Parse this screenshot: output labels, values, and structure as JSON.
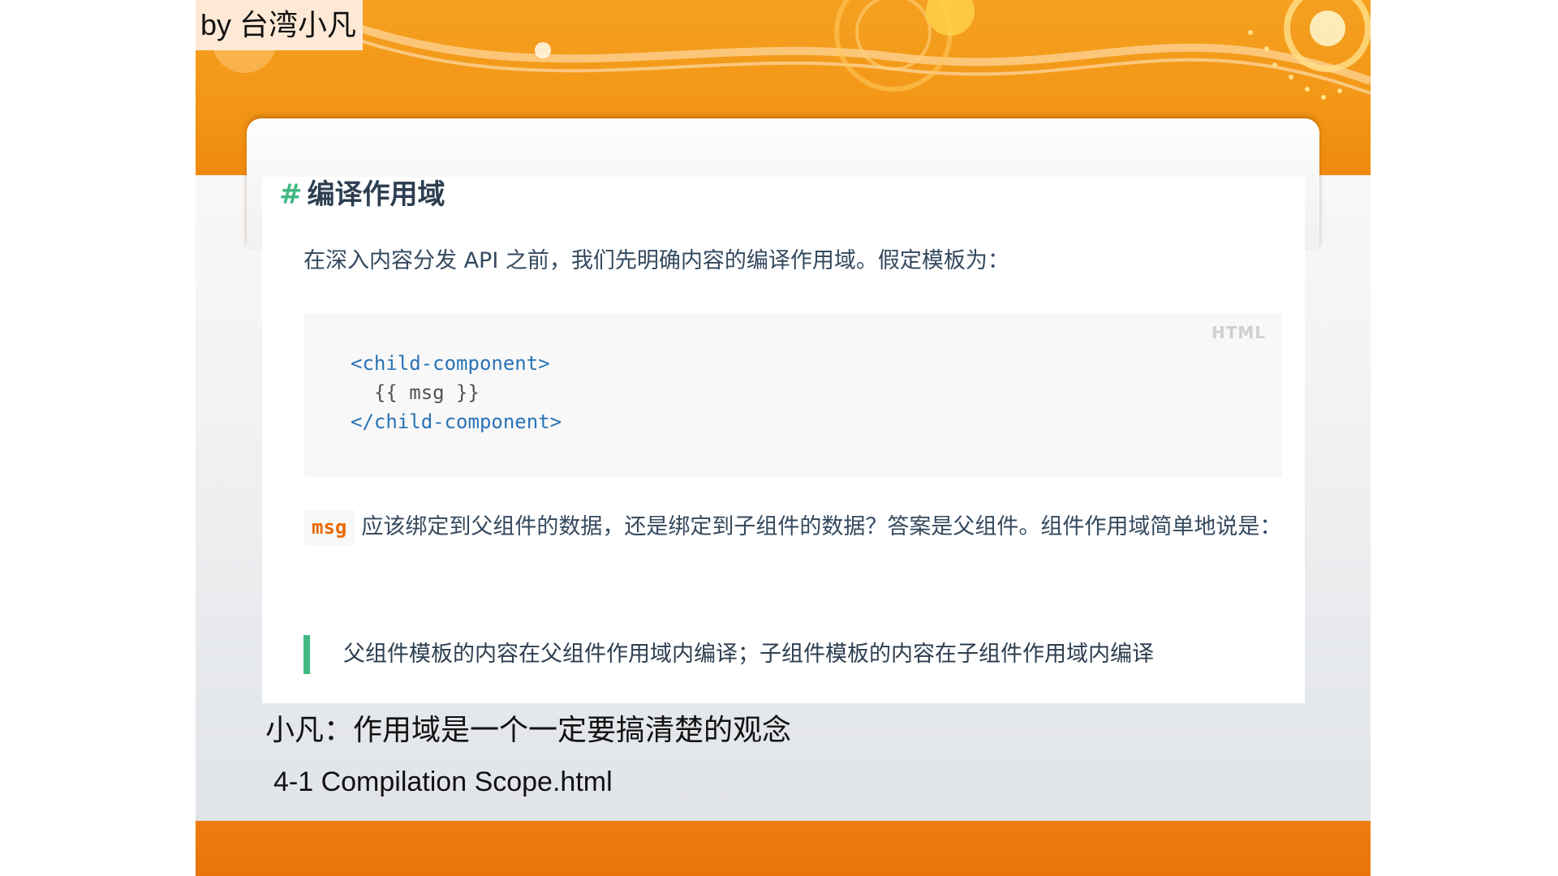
{
  "watermark": "by 台湾小凡",
  "card": {
    "heading_hash": "#",
    "heading": "编译作用域",
    "intro": "在深入内容分发 API 之前，我们先明确内容的编译作用域。假定模板为：",
    "code": {
      "language": "HTML",
      "line1": "<child-component>",
      "line2": "  {{ msg }}",
      "line3": "</child-component>"
    },
    "para": {
      "inline_code": "msg",
      "text": "应该绑定到父组件的数据，还是绑定到子组件的数据？答案是父组件。组件作用域简单地说是："
    },
    "quote": "父组件模板的内容在父组件作用域内编译；子组件模板的内容在子组件作用域内编译"
  },
  "caption": "小凡：作用域是一个一定要搞清楚的观念",
  "filename": "4-1 Compilation Scope.html",
  "colors": {
    "orange": "#f39717",
    "accent_green": "#42b983",
    "code_tag_blue": "#2973b7",
    "inline_code_orange": "#e96900"
  }
}
